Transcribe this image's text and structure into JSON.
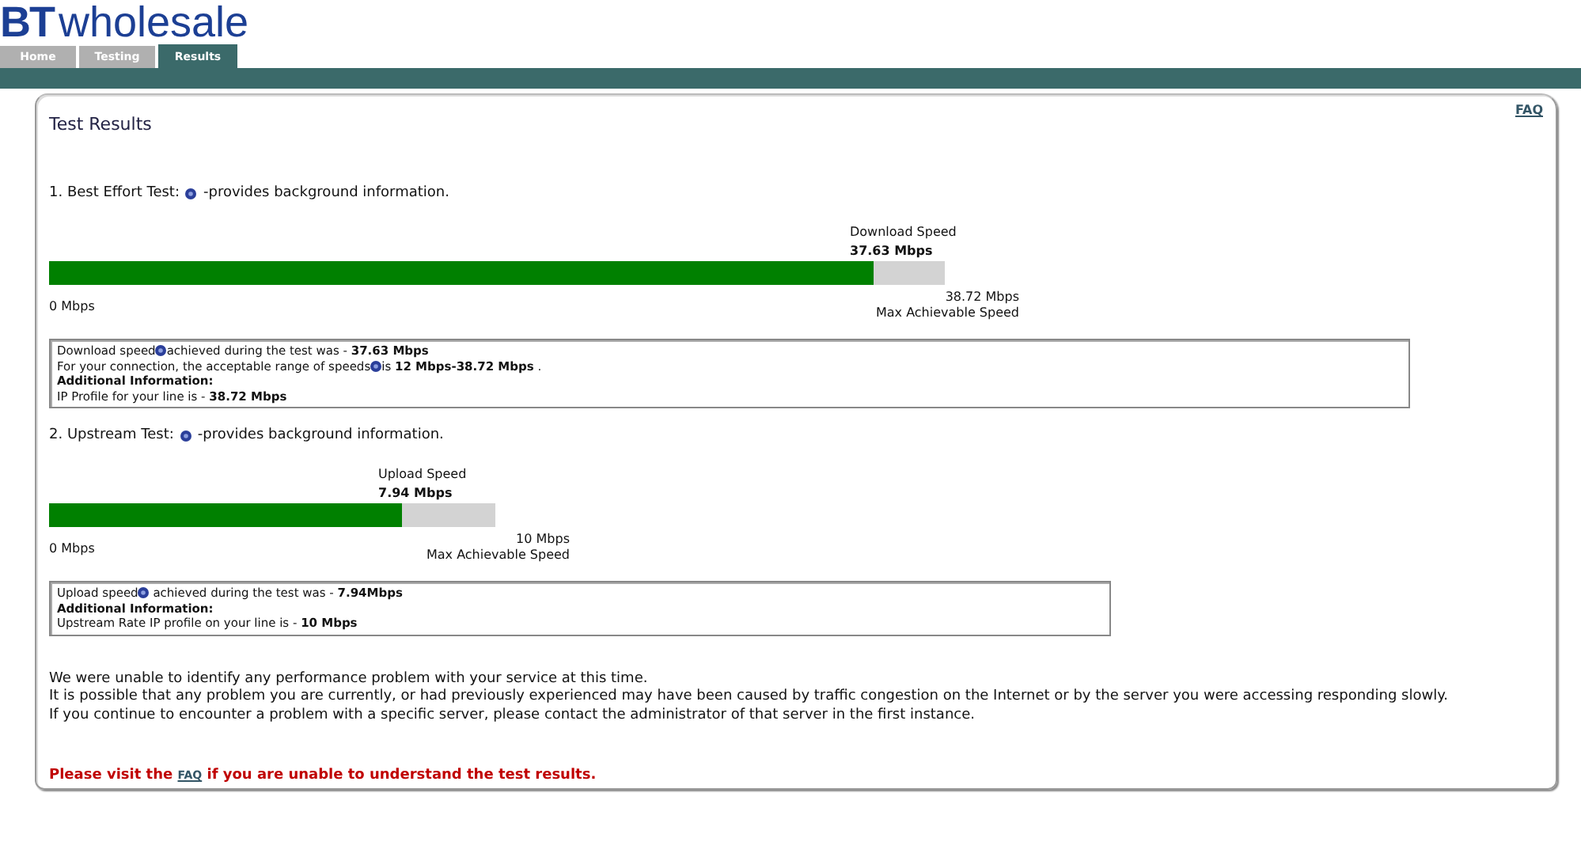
{
  "logo": {
    "mark": "BT",
    "word": "wholesale"
  },
  "tabs": [
    {
      "label": "Home",
      "selected": false
    },
    {
      "label": "Testing",
      "selected": false
    },
    {
      "label": "Results",
      "selected": true
    }
  ],
  "faq_link": "FAQ",
  "title": "Test Results",
  "tests": [
    {
      "heading_before": "1. Best Effort Test:",
      "heading_after": "-provides background information.",
      "speed_label": "Download Speed",
      "speed_value": "37.63 Mbps",
      "level": 0.92,
      "min_label": "0 Mbps",
      "max_value": "38.72 Mbps",
      "max_label": "Max Achievable Speed",
      "info": [
        [
          {
            "kind": "text",
            "text": "Download speed"
          },
          {
            "kind": "help"
          },
          {
            "kind": "text",
            "text": "achieved during the test was - **37.63 Mbps**"
          }
        ],
        [
          {
            "kind": "text",
            "text": "For your connection, the acceptable range of speeds"
          },
          {
            "kind": "help"
          },
          {
            "kind": "text",
            "text": "is **12 Mbps-38.72 Mbps** ."
          }
        ],
        [
          {
            "kind": "bold",
            "text": "Additional Information:"
          }
        ],
        [
          {
            "kind": "text",
            "text": "IP Profile for your line is - **38.72 Mbps**"
          }
        ]
      ]
    },
    {
      "heading_before": "2. Upstream Test:",
      "heading_after": "-provides background information.",
      "speed_label": "Upload Speed",
      "speed_value": "7.94 Mbps",
      "level": 0.79,
      "min_label": "0 Mbps",
      "max_value": "10 Mbps",
      "max_label": "Max Achievable Speed",
      "info": [
        [
          {
            "kind": "text",
            "text": "Upload speed"
          },
          {
            "kind": "help"
          },
          {
            "kind": "text",
            "text": " achieved during the test was - **7.94Mbps**"
          }
        ],
        [
          {
            "kind": "bold",
            "text": "Additional Information:"
          }
        ],
        [
          {
            "kind": "text",
            "text": "Upstream Rate IP profile on your line is - **10 Mbps**"
          }
        ]
      ]
    }
  ],
  "summary": [
    "We were unable to identify any performance problem with your service at this time.",
    "It is possible that any problem you are currently, or had previously experienced may have been caused by traffic congestion on the Internet or by the server you were accessing responding slowly.",
    "If you continue to encounter a problem with a specific server, please contact the administrator of that server in the first instance."
  ],
  "notice": {
    "before": "Please visit the",
    "link": "FAQ",
    "after": "if you are unable to understand the test results."
  }
}
